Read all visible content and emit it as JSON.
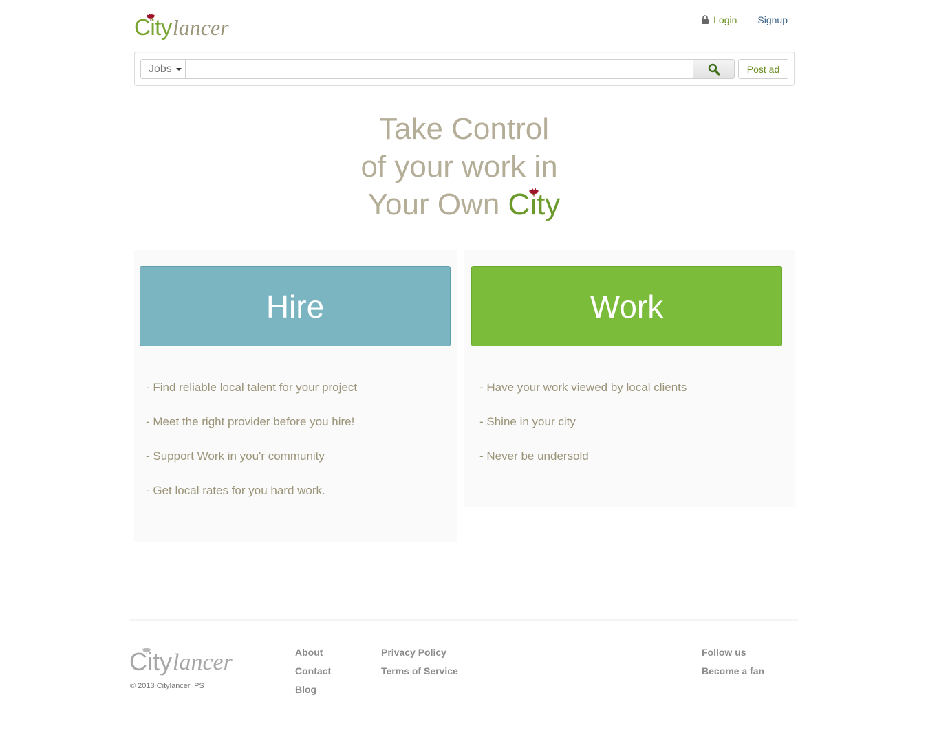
{
  "header": {
    "logo_city": "City",
    "logo_lancer": "lancer",
    "login": "Login",
    "signup": "Signup"
  },
  "search": {
    "category": "Jobs",
    "value": "",
    "placeholder": "",
    "post_ad": "Post ad"
  },
  "hero": {
    "line1": "Take Control",
    "line2": "of your work in",
    "line3_prefix": "Your Own",
    "line3_city": "City"
  },
  "hire": {
    "button": "Hire",
    "features": [
      "- Find reliable local talent for your project",
      "- Meet the right provider before you hire!",
      "- Support Work in you'r community",
      "- Get local rates for you hard work."
    ]
  },
  "work": {
    "button": "Work",
    "features": [
      "- Have your work viewed by local clients",
      "- Shine in your city",
      "- Never be undersold"
    ]
  },
  "footer": {
    "logo_city": "City",
    "logo_lancer": "lancer",
    "copyright": "© 2013 Citylancer, PS",
    "col1": [
      "About",
      "Contact",
      "Blog"
    ],
    "col2": [
      "Privacy Policy",
      "Terms of Service"
    ],
    "col3": [
      "Follow us",
      "Become a fan"
    ]
  },
  "colors": {
    "brand_green": "#7aa532",
    "hire_blue": "#7bb5c2",
    "work_green": "#7bbd3a",
    "hero_text": "#b4ae98",
    "leaf_red": "#a0152a"
  },
  "icons": {
    "lock": "lock-icon",
    "search": "search-icon",
    "caret": "caret-down-icon",
    "leaf": "leaf-icon"
  }
}
